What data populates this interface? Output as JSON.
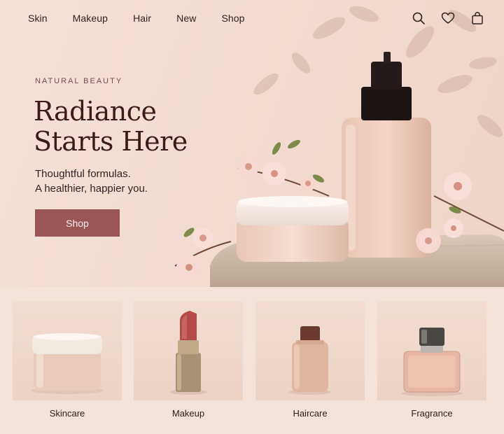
{
  "nav": {
    "items": [
      {
        "label": "Skin"
      },
      {
        "label": "Makeup"
      },
      {
        "label": "Hair"
      },
      {
        "label": "New"
      },
      {
        "label": "Shop"
      }
    ],
    "icons": [
      "search-icon",
      "heart-icon",
      "bag-icon"
    ]
  },
  "hero": {
    "eyebrow": "NATURAL BEAUTY",
    "headline_line1": "Radiance",
    "headline_line2": "Starts Here",
    "subline_line1": "Thoughtful formulas.",
    "subline_line2": "A healthier, happier you.",
    "cta_label": "Shop"
  },
  "categories": [
    {
      "label": "Skincare"
    },
    {
      "label": "Makeup"
    },
    {
      "label": "Haircare"
    },
    {
      "label": "Fragrance"
    }
  ],
  "colors": {
    "accent": "#9c5557",
    "headline": "#3d1a1c",
    "background": "#f3e2d9"
  }
}
